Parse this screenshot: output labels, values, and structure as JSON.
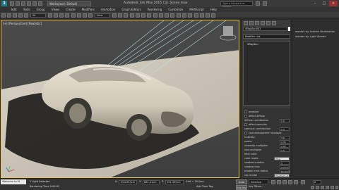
{
  "titlebar": {
    "logo": "3",
    "workspace": "Workspace: Default",
    "title": "Autodesk 3ds Max 2015   Car_Scene.max",
    "search_placeholder": "Type a keyword or phrase"
  },
  "menu": [
    "Edit",
    "Tools",
    "Group",
    "Views",
    "Create",
    "Modifiers",
    "Animation",
    "Graph Editors",
    "Rendering",
    "Customize",
    "MAXScript",
    "Help"
  ],
  "toolbar": {
    "filter": "All",
    "refcoord": "View"
  },
  "viewport": {
    "label": "[+] [Perspective] [Realistic]"
  },
  "command_panel": {
    "object_name": "VRaySun001",
    "modifier_list": "Modifier List",
    "stack_item": "VRaySun",
    "params": [
      {
        "label": "enabled",
        "kind": "check"
      },
      {
        "label": "affect diffuse",
        "kind": "check"
      },
      {
        "label": "diffuse contribution",
        "kind": "value",
        "value": "1.0"
      },
      {
        "label": "affect specular",
        "kind": "check"
      },
      {
        "label": "specular contribution",
        "kind": "value",
        "value": "1.0"
      },
      {
        "label": "cast atmospheric shadows",
        "kind": "check"
      },
      {
        "label": "turbidity",
        "kind": "value",
        "value": "3.0"
      },
      {
        "label": "ozone",
        "kind": "value",
        "value": "0.35"
      },
      {
        "label": "intensity multiplier",
        "kind": "value",
        "value": "0.03"
      },
      {
        "label": "size multiplier",
        "kind": "value",
        "value": "1.0"
      },
      {
        "label": "filter color",
        "kind": "none"
      },
      {
        "label": "color mode",
        "kind": "drop",
        "value": "Filter"
      },
      {
        "label": "shadow subdivs",
        "kind": "value",
        "value": "3"
      },
      {
        "label": "shadow bias",
        "kind": "value",
        "value": "0.2mm"
      },
      {
        "label": "photon emit radius",
        "kind": "value",
        "value": "50.0mm"
      },
      {
        "label": "sky model",
        "kind": "drop",
        "value": "Preetham et al."
      }
    ]
  },
  "material_panel": {
    "line1": "mental ray: Indirect Illumination",
    "line2": "mental ray: Light Shader"
  },
  "status": {
    "maxscript": "Welcome to M",
    "selection": "1 Light Selected",
    "render_time": "Rendering Time 0:00:02",
    "x_label": "X:",
    "x_value": "-904.953cm",
    "y_label": "Y:",
    "y_value": "861.41cm",
    "z_label": "Z:",
    "z_value": "591.335cm",
    "grid": "Grid = 10.0cm",
    "add_time_tag": "Add Time Tag",
    "auto_key": "Auto Key",
    "set_key": "Set Key",
    "selected": "Selected",
    "key_filters": "Key Filters...",
    "frame": "0"
  },
  "colors": {
    "viewport_bg": "#494949",
    "active_border": "#e8c44a",
    "close_button": "#9a3030"
  }
}
